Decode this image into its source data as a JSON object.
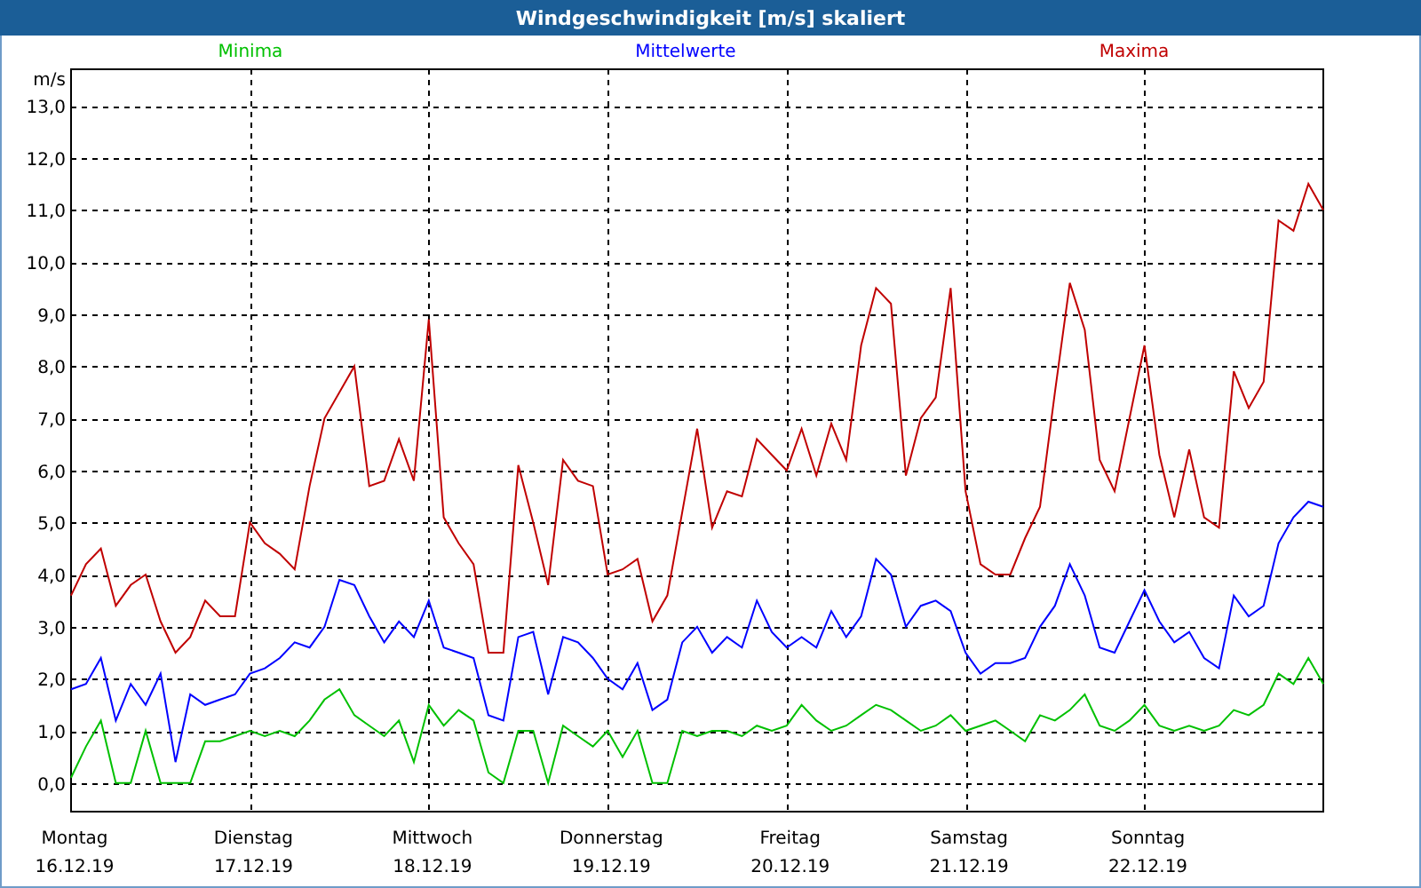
{
  "window": {
    "title": "Windgeschwindigkeit [m/s] skaliert"
  },
  "chart": {
    "tick_dates": [
      "16.12.19",
      "17.12.19",
      "18.12.19",
      "19.12.19",
      "20.12.19",
      "21.12.19",
      "22.12.19"
    ],
    "chart_data": {
      "type": "line",
      "grid": true,
      "ylabel": "m/s",
      "ylim": [
        -0.55,
        13.7
      ],
      "categories": [
        "Montag",
        null,
        null,
        null,
        null,
        null,
        null,
        null,
        null,
        null,
        null,
        null,
        "Dienstag",
        null,
        null,
        null,
        null,
        null,
        null,
        null,
        null,
        null,
        null,
        null,
        "Mittwoch",
        null,
        null,
        null,
        null,
        null,
        null,
        null,
        null,
        null,
        null,
        null,
        "Donnerstag",
        null,
        null,
        null,
        null,
        null,
        null,
        null,
        null,
        null,
        null,
        null,
        "Freitag",
        null,
        null,
        null,
        null,
        null,
        null,
        null,
        null,
        null,
        null,
        null,
        "Samstag",
        null,
        null,
        null,
        null,
        null,
        null,
        null,
        null,
        null,
        null,
        null,
        "Sonntag",
        null,
        null,
        null,
        null,
        null,
        null,
        null,
        null,
        null,
        null,
        null,
        null
      ],
      "yticks": [
        {
          "value": 0,
          "label": "0,0"
        },
        {
          "value": 1,
          "label": "1,0"
        },
        {
          "value": 2,
          "label": "2,0"
        },
        {
          "value": 3,
          "label": "3,0"
        },
        {
          "value": 4,
          "label": "4,0"
        },
        {
          "value": 5,
          "label": "5,0"
        },
        {
          "value": 6,
          "label": "6,0"
        },
        {
          "value": 7,
          "label": "7,0"
        },
        {
          "value": 8,
          "label": "8,0"
        },
        {
          "value": 9,
          "label": "9,0"
        },
        {
          "value": 10,
          "label": "10,0"
        },
        {
          "value": 11,
          "label": "11,0"
        },
        {
          "value": 12,
          "label": "12,0"
        },
        {
          "value": 13,
          "label": "13,0"
        }
      ],
      "series": [
        {
          "name": "Minima",
          "color": "#00c000",
          "values": [
            0.1,
            0.7,
            1.2,
            0.0,
            0.0,
            1.0,
            0.0,
            0.0,
            0.0,
            0.8,
            0.8,
            0.9,
            1.0,
            0.9,
            1.0,
            0.9,
            1.2,
            1.6,
            1.8,
            1.3,
            1.1,
            0.9,
            1.2,
            0.4,
            1.5,
            1.1,
            1.4,
            1.2,
            0.2,
            0.0,
            1.0,
            1.0,
            0.0,
            1.1,
            0.9,
            0.7,
            1.0,
            0.5,
            1.0,
            0.0,
            0.0,
            1.0,
            0.9,
            1.0,
            1.0,
            0.9,
            1.1,
            1.0,
            1.1,
            1.5,
            1.2,
            1.0,
            1.1,
            1.3,
            1.5,
            1.4,
            1.2,
            1.0,
            1.1,
            1.3,
            1.0,
            1.1,
            1.2,
            1.0,
            0.8,
            1.3,
            1.2,
            1.4,
            1.7,
            1.1,
            1.0,
            1.2,
            1.5,
            1.1,
            1.0,
            1.1,
            1.0,
            1.1,
            1.4,
            1.3,
            1.5,
            2.1,
            1.9,
            2.4,
            1.9
          ]
        },
        {
          "name": "Mittelwerte",
          "color": "#0000ff",
          "values": [
            1.8,
            1.9,
            2.4,
            1.2,
            1.9,
            1.5,
            2.1,
            0.4,
            1.7,
            1.5,
            1.6,
            1.7,
            2.1,
            2.2,
            2.4,
            2.7,
            2.6,
            3.0,
            3.9,
            3.8,
            3.2,
            2.7,
            3.1,
            2.8,
            3.5,
            2.6,
            2.5,
            2.4,
            1.3,
            1.2,
            2.8,
            2.9,
            1.7,
            2.8,
            2.7,
            2.4,
            2.0,
            1.8,
            2.3,
            1.4,
            1.6,
            2.7,
            3.0,
            2.5,
            2.8,
            2.6,
            3.5,
            2.9,
            2.6,
            2.8,
            2.6,
            3.3,
            2.8,
            3.2,
            4.3,
            4.0,
            3.0,
            3.4,
            3.5,
            3.3,
            2.5,
            2.1,
            2.3,
            2.3,
            2.4,
            3.0,
            3.4,
            4.2,
            3.6,
            2.6,
            2.5,
            3.1,
            3.7,
            3.1,
            2.7,
            2.9,
            2.4,
            2.2,
            3.6,
            3.2,
            3.4,
            4.6,
            5.1,
            5.4,
            5.3
          ]
        },
        {
          "name": "Maxima",
          "color": "#c00000",
          "values": [
            3.6,
            4.2,
            4.5,
            3.4,
            3.8,
            4.0,
            3.1,
            2.5,
            2.8,
            3.5,
            3.2,
            3.2,
            5.0,
            4.6,
            4.4,
            4.1,
            5.7,
            7.0,
            7.5,
            8.0,
            5.7,
            5.8,
            6.6,
            5.8,
            8.9,
            5.1,
            4.6,
            4.2,
            2.5,
            2.5,
            6.1,
            5.0,
            3.8,
            6.2,
            5.8,
            5.7,
            4.0,
            4.1,
            4.3,
            3.1,
            3.6,
            5.2,
            6.8,
            4.9,
            5.6,
            5.5,
            6.6,
            6.3,
            6.0,
            6.8,
            5.9,
            6.9,
            6.2,
            8.4,
            9.5,
            9.2,
            5.9,
            7.0,
            7.4,
            9.5,
            5.6,
            4.2,
            4.0,
            4.0,
            4.7,
            5.3,
            7.5,
            9.6,
            8.7,
            6.2,
            5.6,
            7.0,
            8.4,
            6.3,
            5.1,
            6.4,
            5.1,
            4.9,
            7.9,
            7.2,
            7.7,
            10.8,
            10.6,
            11.5,
            11.0
          ]
        }
      ]
    }
  }
}
